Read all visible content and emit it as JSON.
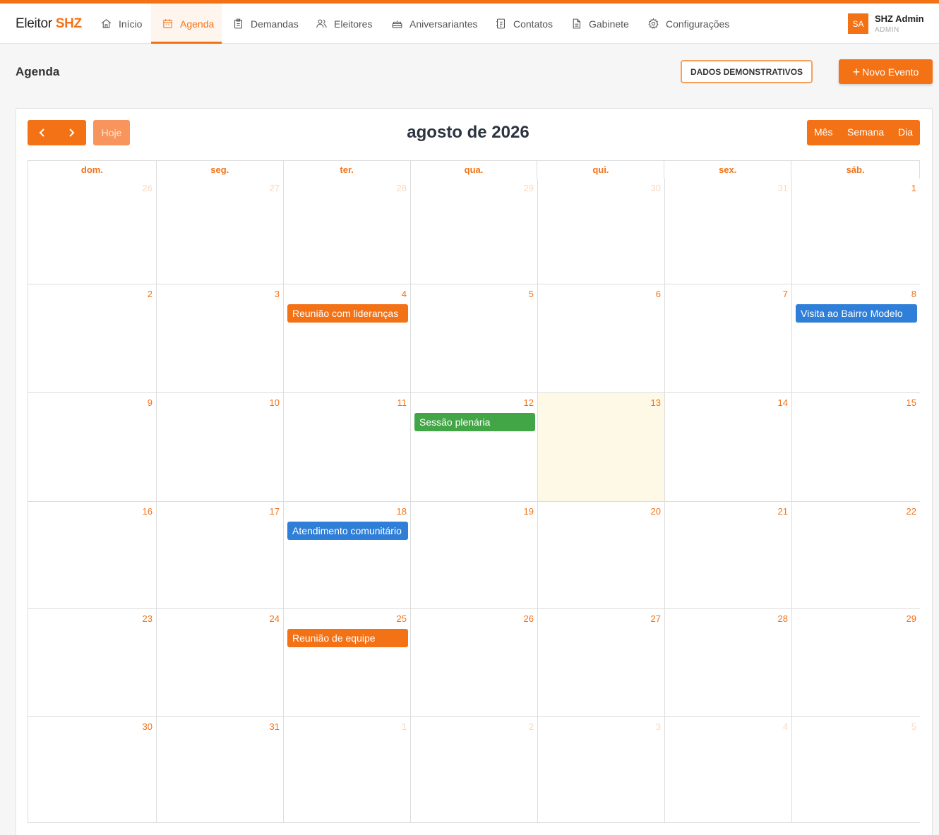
{
  "brand": {
    "prefix": "Eleitor",
    "accent": "SHZ"
  },
  "nav": {
    "items": [
      {
        "label": "Início",
        "icon": "home-icon"
      },
      {
        "label": "Agenda",
        "icon": "calendar-icon",
        "active": true
      },
      {
        "label": "Demandas",
        "icon": "clipboard-icon"
      },
      {
        "label": "Eleitores",
        "icon": "users-icon"
      },
      {
        "label": "Aniversariantes",
        "icon": "cake-icon"
      },
      {
        "label": "Contatos",
        "icon": "contacts-icon"
      },
      {
        "label": "Gabinete",
        "icon": "document-icon"
      },
      {
        "label": "Configurações",
        "icon": "gear-icon"
      }
    ]
  },
  "user": {
    "initials": "SA",
    "name": "SHZ Admin",
    "role": "ADMIN"
  },
  "page": {
    "title": "Agenda",
    "demo_label": "DADOS DEMONSTRATIVOS",
    "new_event_label": "Novo Evento"
  },
  "calendar": {
    "title": "agosto de 2026",
    "today_label": "Hoje",
    "views": [
      "Mês",
      "Semana",
      "Dia"
    ],
    "weekdays": [
      "dom.",
      "seg.",
      "ter.",
      "qua.",
      "qui.",
      "sex.",
      "sáb."
    ],
    "weeks": [
      [
        "26",
        "27",
        "28",
        "29",
        "30",
        "31",
        "1"
      ],
      [
        "2",
        "3",
        "4",
        "5",
        "6",
        "7",
        "8"
      ],
      [
        "9",
        "10",
        "11",
        "12",
        "13",
        "14",
        "15"
      ],
      [
        "16",
        "17",
        "18",
        "19",
        "20",
        "21",
        "22"
      ],
      [
        "23",
        "24",
        "25",
        "26",
        "27",
        "28",
        "29"
      ],
      [
        "30",
        "31",
        "1",
        "2",
        "3",
        "4",
        "5"
      ]
    ],
    "today_day": "13",
    "events": [
      {
        "title": "Reunião com lideranças",
        "week": 1,
        "day": 2,
        "color": "#f47216"
      },
      {
        "title": "Visita ao Bairro Modelo",
        "week": 1,
        "day": 6,
        "color": "#2f7fd8"
      },
      {
        "title": "Sessão plenária",
        "week": 2,
        "day": 3,
        "color": "#43a646"
      },
      {
        "title": "Atendimento comunitário",
        "week": 3,
        "day": 2,
        "color": "#2f7fd8"
      },
      {
        "title": "Reunião de equipe",
        "week": 4,
        "day": 2,
        "color": "#f47216"
      }
    ]
  },
  "colors": {
    "accent": "#f47216",
    "blue": "#2f7fd8",
    "green": "#43a646",
    "today_bg": "#fef8e6"
  }
}
